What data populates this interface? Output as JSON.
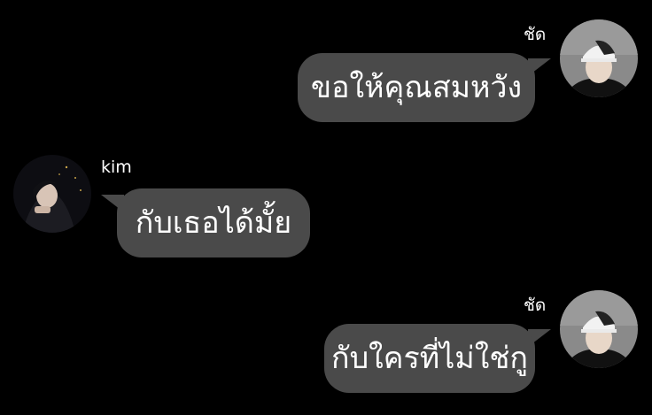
{
  "messages": [
    {
      "sender": "ชัด",
      "side": "right",
      "text": "ขอให้คุณสมหวัง",
      "avatar": "user-cap-avatar"
    },
    {
      "sender": "kim",
      "side": "left",
      "text": "กับเธอได้มั้ย",
      "avatar": "user-dark-avatar"
    },
    {
      "sender": "ชัด",
      "side": "right",
      "text": "กับใครที่ไม่ใช่กู",
      "avatar": "user-cap-avatar"
    }
  ],
  "colors": {
    "background": "#000000",
    "bubble": "#4a4a4a",
    "text": "#ffffff"
  }
}
